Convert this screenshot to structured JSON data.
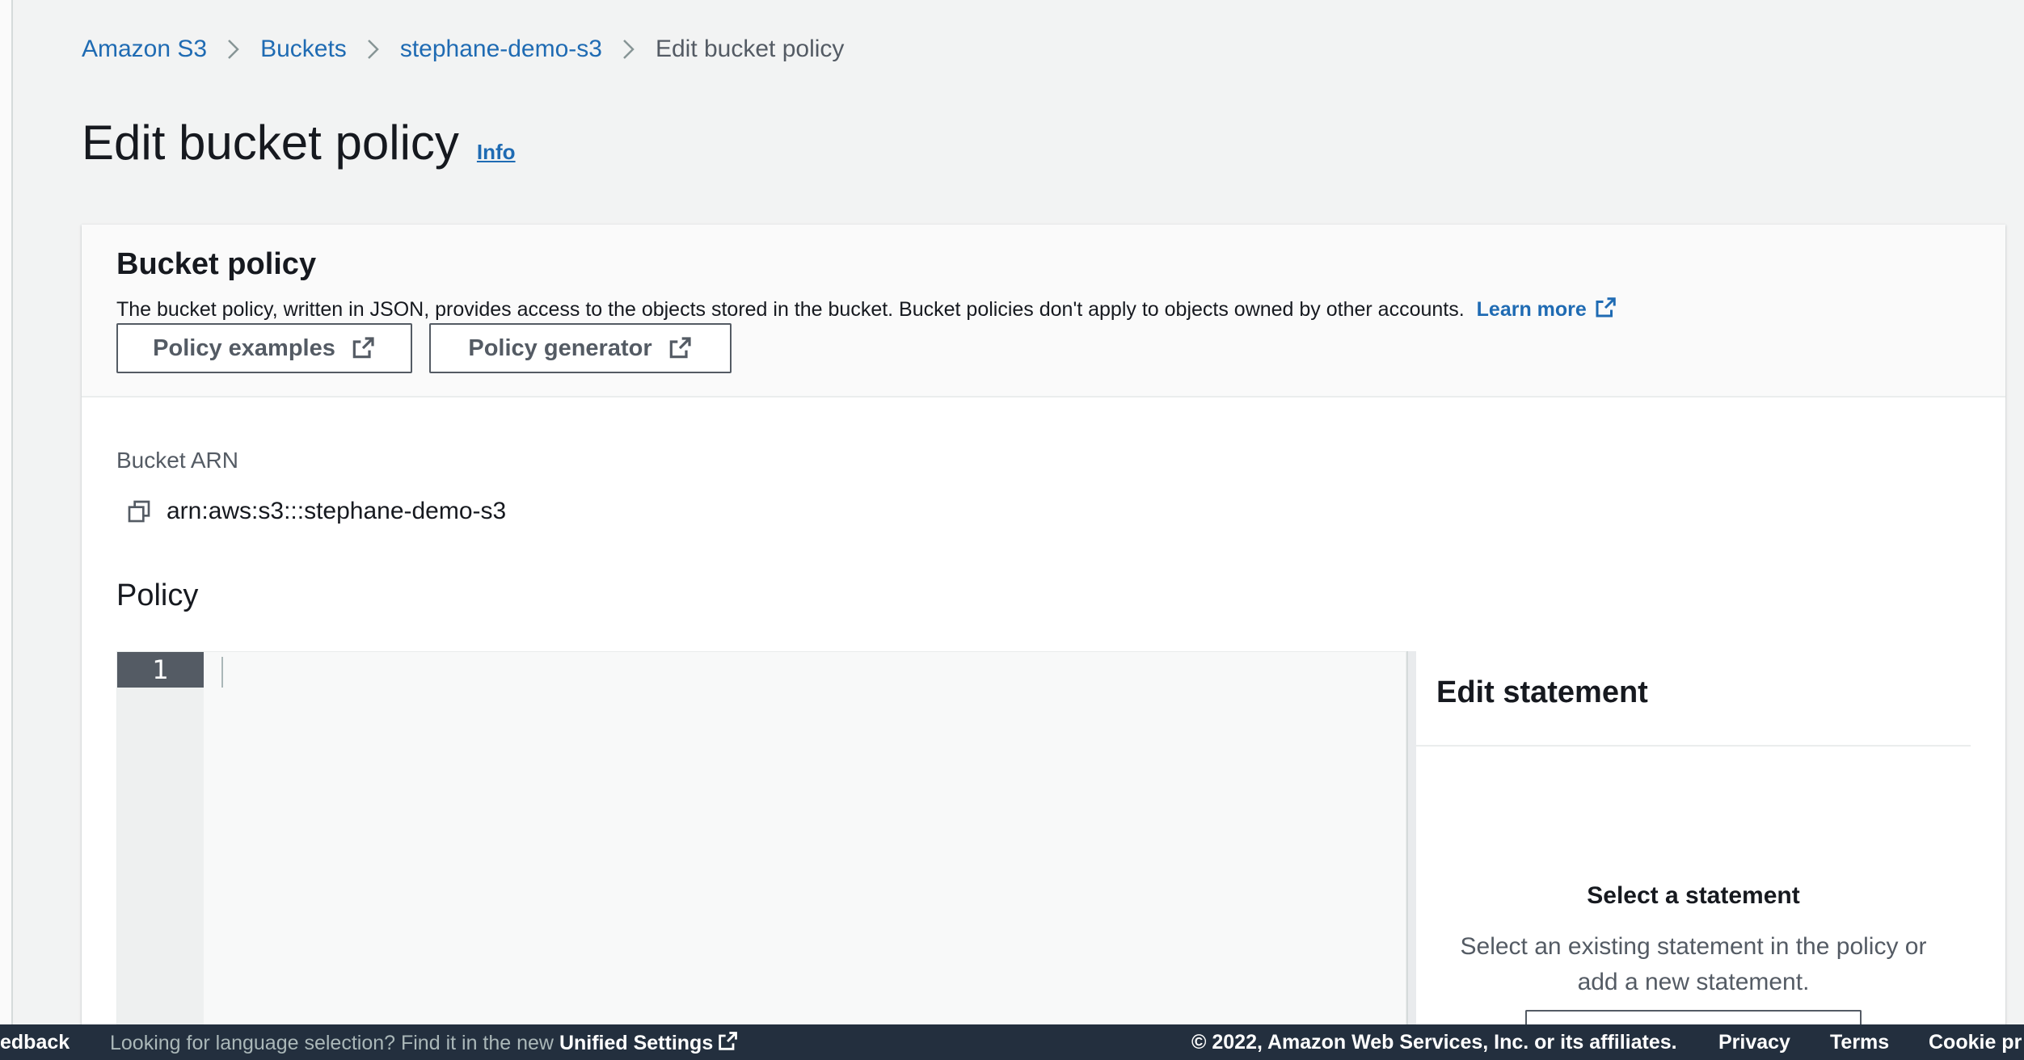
{
  "breadcrumb": {
    "items": [
      "Amazon S3",
      "Buckets",
      "stephane-demo-s3"
    ],
    "current": "Edit bucket policy"
  },
  "page": {
    "title": "Edit bucket policy",
    "info_link": "Info"
  },
  "bucket_policy": {
    "heading": "Bucket policy",
    "description": "The bucket policy, written in JSON, provides access to the objects stored in the bucket. Bucket policies don't apply to objects owned by other accounts.",
    "learn_more": "Learn more",
    "buttons": {
      "policy_examples": "Policy examples",
      "policy_generator": "Policy generator"
    },
    "arn_label": "Bucket ARN",
    "arn_value": "arn:aws:s3:::stephane-demo-s3",
    "policy_label": "Policy",
    "editor": {
      "line_numbers": [
        "1"
      ],
      "content": ""
    }
  },
  "statement_panel": {
    "heading": "Edit statement",
    "empty_title": "Select a statement",
    "empty_description": "Select an existing statement in the policy or add a new statement."
  },
  "footer": {
    "feedback": "edback",
    "language_prompt": "Looking for language selection? Find it in the new",
    "unified_settings": "Unified Settings",
    "copyright": "© 2022, Amazon Web Services, Inc. or its affiliates.",
    "privacy": "Privacy",
    "terms": "Terms",
    "cookie": "Cookie pr"
  },
  "icons": {
    "breadcrumb_separator": "chevron-right-icon",
    "external_link": "external-link-icon",
    "copy": "copy-icon"
  },
  "colors": {
    "link": "#1f6bb3",
    "background": "#f2f3f3",
    "footer": "#232f3e",
    "line_number_active": "#545b64"
  }
}
